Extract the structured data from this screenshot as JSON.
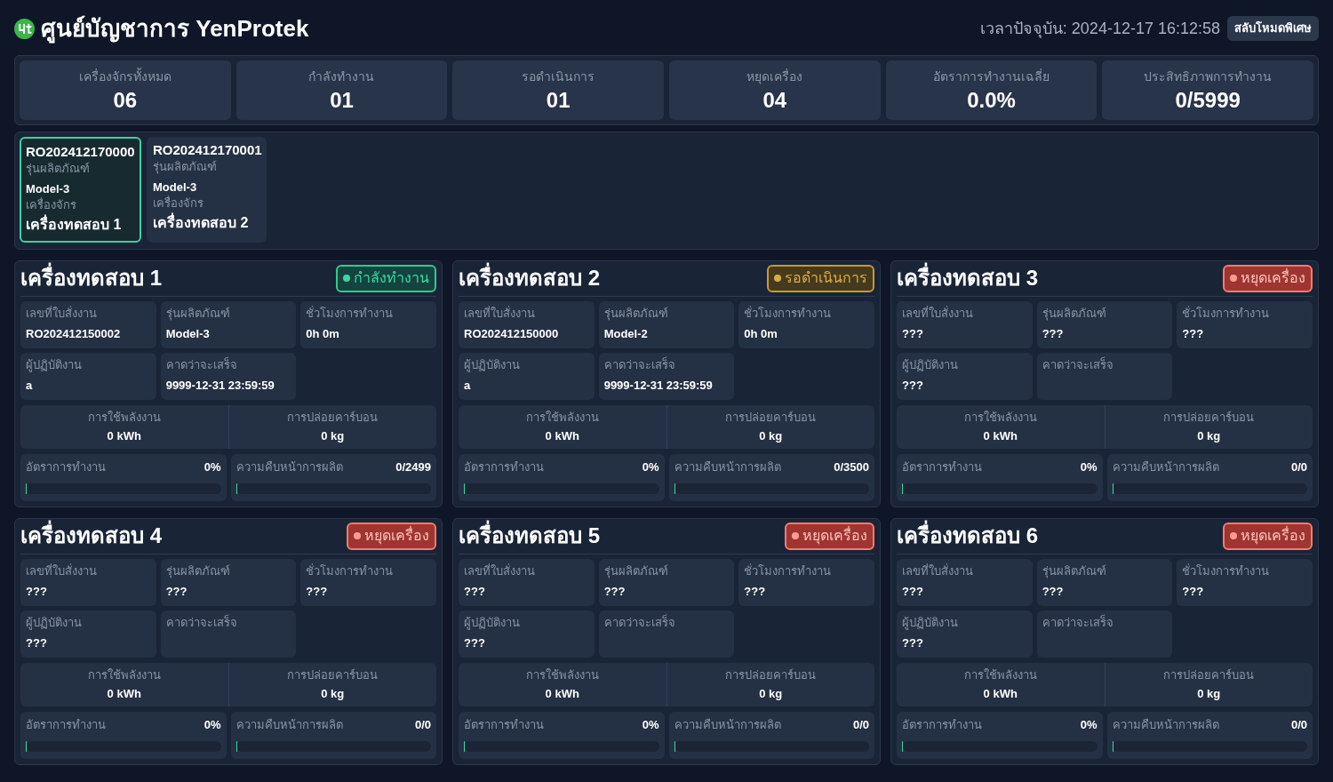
{
  "header": {
    "title": "ศูนย์บัญชาการ YenProtek",
    "clock": "เวลาปัจจุบัน: 2024-12-17 16:12:58",
    "mode_button": "สลับโหมดพิเศษ"
  },
  "summary": [
    {
      "label": "เครื่องจักรทั้งหมด",
      "value": "06"
    },
    {
      "label": "กำลังทำงาน",
      "value": "01"
    },
    {
      "label": "รอดำเนินการ",
      "value": "01"
    },
    {
      "label": "หยุดเครื่อง",
      "value": "04"
    },
    {
      "label": "อัตราการทำงานเฉลี่ย",
      "value": "0.0%"
    },
    {
      "label": "ประสิทธิภาพการทำงาน",
      "value": "0/5999"
    }
  ],
  "orders": [
    {
      "order_no": "RO202412170000",
      "model_label": "รุ่นผลิตภัณฑ์",
      "model": "Model-3",
      "machine_label": "เครื่องจักร",
      "machine": "เครื่องทดสอบ 1",
      "selected": true
    },
    {
      "order_no": "RO202412170001",
      "model_label": "รุ่นผลิตภัณฑ์",
      "model": "Model-3",
      "machine_label": "เครื่องจักร",
      "machine": "เครื่องทดสอบ 2",
      "selected": false
    }
  ],
  "machines": [
    {
      "name": "เครื่องทดสอบ 1",
      "kind": "running",
      "status_label": "กำลังทำงาน",
      "color": "#3fd6a0",
      "fields": [
        {
          "label": "เลขที่ใบสั่งงาน",
          "value": "RO202412150002"
        },
        {
          "label": "รุ่นผลิตภัณฑ์",
          "value": "Model-3"
        },
        {
          "label": "ชั่วโมงการทำงาน",
          "value": "0h 0m"
        },
        {
          "label": "ผู้ปฏิบัติงาน",
          "value": "a"
        },
        {
          "label": "คาดว่าจะเสร็จ",
          "value": "9999-12-31 23:59:59"
        }
      ],
      "energy": {
        "label": "การใช้พลังงาน",
        "value": "0 kWh"
      },
      "carbon": {
        "label": "การปล่อยคาร์บอน",
        "value": "0 kg"
      },
      "rate": {
        "label": "อัตราการทำงาน",
        "reading": "0%",
        "level": 0
      },
      "progress": {
        "label": "ความคืบหน้าการผลิต",
        "reading": "0/2499",
        "level": 0
      }
    },
    {
      "name": "เครื่องทดสอบ 2",
      "kind": "pending",
      "status_label": "รอดำเนินการ",
      "color": "#d9ab45",
      "fields": [
        {
          "label": "เลขที่ใบสั่งงาน",
          "value": "RO202412150000"
        },
        {
          "label": "รุ่นผลิตภัณฑ์",
          "value": "Model-2"
        },
        {
          "label": "ชั่วโมงการทำงาน",
          "value": "0h 0m"
        },
        {
          "label": "ผู้ปฏิบัติงาน",
          "value": "a"
        },
        {
          "label": "คาดว่าจะเสร็จ",
          "value": "9999-12-31 23:59:59"
        }
      ],
      "energy": {
        "label": "การใช้พลังงาน",
        "value": "0 kWh"
      },
      "carbon": {
        "label": "การปล่อยคาร์บอน",
        "value": "0 kg"
      },
      "rate": {
        "label": "อัตราการทำงาน",
        "reading": "0%",
        "level": 0
      },
      "progress": {
        "label": "ความคืบหน้าการผลิต",
        "reading": "0/3500",
        "level": 0
      }
    },
    {
      "name": "เครื่องทดสอบ 3",
      "kind": "stopped",
      "status_label": "หยุดเครื่อง",
      "color": "#ff9d94",
      "fields": [
        {
          "label": "เลขที่ใบสั่งงาน",
          "value": "???"
        },
        {
          "label": "รุ่นผลิตภัณฑ์",
          "value": "???"
        },
        {
          "label": "ชั่วโมงการทำงาน",
          "value": "???"
        },
        {
          "label": "ผู้ปฏิบัติงาน",
          "value": "???"
        },
        {
          "label": "คาดว่าจะเสร็จ"
        }
      ],
      "energy": {
        "label": "การใช้พลังงาน",
        "value": "0 kWh"
      },
      "carbon": {
        "label": "การปล่อยคาร์บอน",
        "value": "0 kg"
      },
      "rate": {
        "label": "อัตราการทำงาน",
        "reading": "0%",
        "level": 0
      },
      "progress": {
        "label": "ความคืบหน้าการผลิต",
        "reading": "0/0",
        "level": 0
      }
    },
    {
      "name": "เครื่องทดสอบ 4",
      "kind": "stopped",
      "status_label": "หยุดเครื่อง",
      "color": "#ff9d94",
      "fields": [
        {
          "label": "เลขที่ใบสั่งงาน",
          "value": "???"
        },
        {
          "label": "รุ่นผลิตภัณฑ์",
          "value": "???"
        },
        {
          "label": "ชั่วโมงการทำงาน",
          "value": "???"
        },
        {
          "label": "ผู้ปฏิบัติงาน",
          "value": "???"
        },
        {
          "label": "คาดว่าจะเสร็จ"
        }
      ],
      "energy": {
        "label": "การใช้พลังงาน",
        "value": "0 kWh"
      },
      "carbon": {
        "label": "การปล่อยคาร์บอน",
        "value": "0 kg"
      },
      "rate": {
        "label": "อัตราการทำงาน",
        "reading": "0%",
        "level": 0
      },
      "progress": {
        "label": "ความคืบหน้าการผลิต",
        "reading": "0/0",
        "level": 0
      }
    },
    {
      "name": "เครื่องทดสอบ 5",
      "kind": "stopped",
      "status_label": "หยุดเครื่อง",
      "color": "#ff9d94",
      "fields": [
        {
          "label": "เลขที่ใบสั่งงาน",
          "value": "???"
        },
        {
          "label": "รุ่นผลิตภัณฑ์",
          "value": "???"
        },
        {
          "label": "ชั่วโมงการทำงาน",
          "value": "???"
        },
        {
          "label": "ผู้ปฏิบัติงาน",
          "value": "???"
        },
        {
          "label": "คาดว่าจะเสร็จ"
        }
      ],
      "energy": {
        "label": "การใช้พลังงาน",
        "value": "0 kWh"
      },
      "carbon": {
        "label": "การปล่อยคาร์บอน",
        "value": "0 kg"
      },
      "rate": {
        "label": "อัตราการทำงาน",
        "reading": "0%",
        "level": 0
      },
      "progress": {
        "label": "ความคืบหน้าการผลิต",
        "reading": "0/0",
        "level": 0
      }
    },
    {
      "name": "เครื่องทดสอบ 6",
      "kind": "stopped",
      "status_label": "หยุดเครื่อง",
      "color": "#ff9d94",
      "fields": [
        {
          "label": "เลขที่ใบสั่งงาน",
          "value": "???"
        },
        {
          "label": "รุ่นผลิตภัณฑ์",
          "value": "???"
        },
        {
          "label": "ชั่วโมงการทำงาน",
          "value": "???"
        },
        {
          "label": "ผู้ปฏิบัติงาน",
          "value": "???"
        },
        {
          "label": "คาดว่าจะเสร็จ"
        }
      ],
      "energy": {
        "label": "การใช้พลังงาน",
        "value": "0 kWh"
      },
      "carbon": {
        "label": "การปล่อยคาร์บอน",
        "value": "0 kg"
      },
      "rate": {
        "label": "อัตราการทำงาน",
        "reading": "0%",
        "level": 0
      },
      "progress": {
        "label": "ความคืบหน้าการผลิต",
        "reading": "0/0",
        "level": 0
      }
    }
  ]
}
